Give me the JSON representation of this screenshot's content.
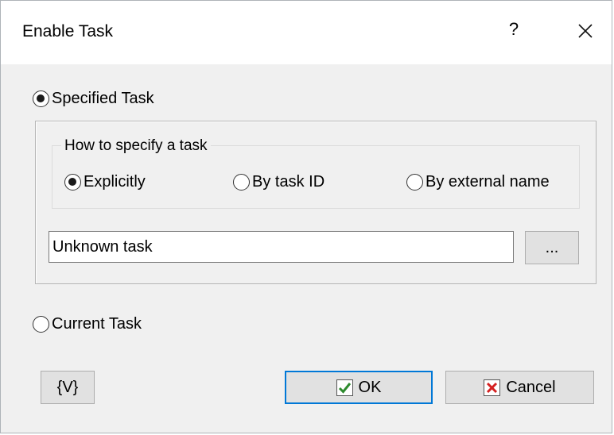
{
  "window": {
    "title": "Enable Task",
    "help_label": "?",
    "close_label": "close"
  },
  "specified_task": {
    "label": "Specified Task",
    "checked": true
  },
  "how_to_specify": {
    "legend": "How to specify a task",
    "options": [
      {
        "label": "Explicitly",
        "checked": true
      },
      {
        "label": "By task ID",
        "checked": false
      },
      {
        "label": "By external name",
        "checked": false
      }
    ]
  },
  "task_field": {
    "value": "Unknown task"
  },
  "browse_button": {
    "label": "..."
  },
  "current_task": {
    "label": "Current Task",
    "checked": false
  },
  "buttons": {
    "variables_label": "{V}",
    "ok_label": "OK",
    "cancel_label": "Cancel",
    "ok_icon": "checkmark-icon",
    "cancel_icon": "red-x-icon"
  },
  "colors": {
    "ok_icon_color": "#2e8b2e",
    "cancel_icon_color": "#d42020",
    "default_button_border": "#0078d7",
    "dialog_background": "#f0f0f0"
  }
}
